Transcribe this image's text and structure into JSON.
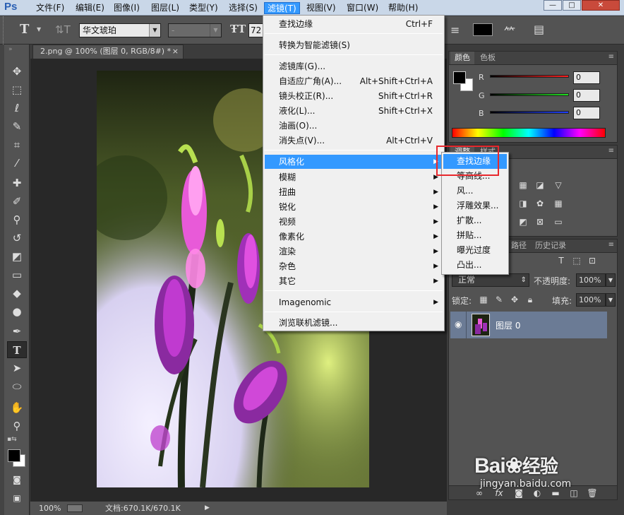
{
  "app": {
    "logo": "Ps"
  },
  "menubar": {
    "items": [
      "文件(F)",
      "编辑(E)",
      "图像(I)",
      "图层(L)",
      "类型(Y)",
      "选择(S)",
      "滤镜(T)",
      "视图(V)",
      "窗口(W)",
      "帮助(H)"
    ],
    "active": "滤镜(T)",
    "window_buttons": [
      "—",
      "□",
      "✕"
    ]
  },
  "options": {
    "font_family": "华文琥珀",
    "font_style": "-",
    "font_size": "72"
  },
  "document": {
    "tab": "2.png @ 100% (图层 0, RGB/8#) *",
    "close": "×",
    "zoom": "100%",
    "doc_info": "文档:670.1K/670.1K"
  },
  "filter_menu": {
    "items": [
      {
        "label": "查找边缘",
        "shortcut": "Ctrl+F"
      },
      {
        "label": "转换为智能滤镜(S)",
        "shortcut": ""
      },
      {
        "label": "滤镜库(G)...",
        "shortcut": ""
      },
      {
        "label": "自适应广角(A)...",
        "shortcut": "Alt+Shift+Ctrl+A"
      },
      {
        "label": "镜头校正(R)...",
        "shortcut": "Shift+Ctrl+R"
      },
      {
        "label": "液化(L)...",
        "shortcut": "Shift+Ctrl+X"
      },
      {
        "label": "油画(O)...",
        "shortcut": ""
      },
      {
        "label": "消失点(V)...",
        "shortcut": "Alt+Ctrl+V"
      },
      {
        "label": "风格化",
        "shortcut": ""
      },
      {
        "label": "模糊",
        "shortcut": ""
      },
      {
        "label": "扭曲",
        "shortcut": ""
      },
      {
        "label": "锐化",
        "shortcut": ""
      },
      {
        "label": "视频",
        "shortcut": ""
      },
      {
        "label": "像素化",
        "shortcut": ""
      },
      {
        "label": "渲染",
        "shortcut": ""
      },
      {
        "label": "杂色",
        "shortcut": ""
      },
      {
        "label": "其它",
        "shortcut": ""
      },
      {
        "label": "Imagenomic",
        "shortcut": ""
      },
      {
        "label": "浏览联机滤镜...",
        "shortcut": ""
      }
    ],
    "highlighted": "风格化"
  },
  "stylize_submenu": {
    "items": [
      "查找边缘",
      "等高线...",
      "风...",
      "浮雕效果...",
      "扩散...",
      "拼贴...",
      "曝光过度",
      "凸出..."
    ],
    "highlighted": "查找边缘"
  },
  "color_panel": {
    "tabs": [
      "颜色",
      "色板"
    ],
    "channels": [
      {
        "label": "R",
        "value": "0",
        "color": "#e02020"
      },
      {
        "label": "G",
        "value": "0",
        "color": "#20c020"
      },
      {
        "label": "B",
        "value": "0",
        "color": "#2040e0"
      }
    ]
  },
  "adjust_panel": {
    "tabs": [
      "调整",
      "样式"
    ]
  },
  "layers_panel": {
    "tabs": [
      "路径",
      "历史记录"
    ],
    "blend_mode": "正常",
    "opacity_label": "不透明度:",
    "opacity": "100%",
    "lock_label": "锁定:",
    "fill_label": "填充:",
    "fill": "100%",
    "layers": [
      {
        "name": "图层 0"
      }
    ]
  },
  "watermark": {
    "brand": "Bai",
    "brand2": "经验",
    "url": "jingyan.baidu.com"
  }
}
